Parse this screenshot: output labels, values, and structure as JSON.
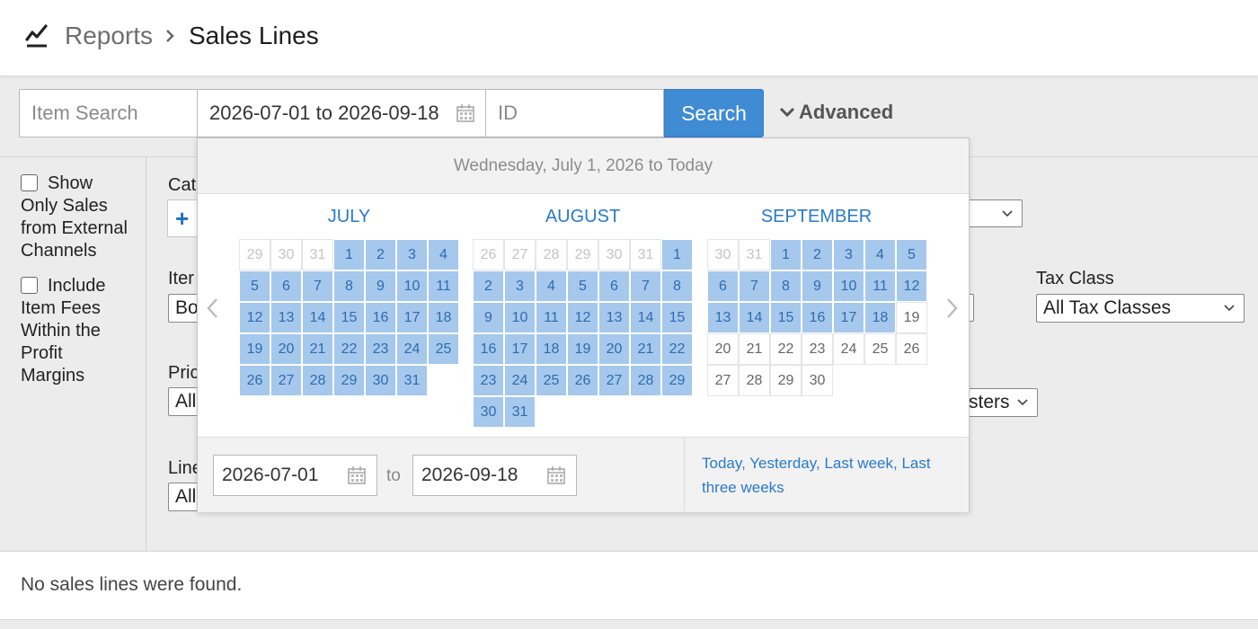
{
  "breadcrumb": {
    "parent": "Reports",
    "current": "Sales Lines"
  },
  "search": {
    "item_placeholder": "Item Search",
    "date_range_value": "2026-07-01 to 2026-09-18",
    "id_placeholder": "ID",
    "search_label": "Search",
    "advanced_label": "Advanced"
  },
  "sidebar": {
    "external_channels_label": "Show Only Sales from External Channels",
    "item_fees_label": "Include Item Fees Within the Profit Margins"
  },
  "filters": {
    "category_fragment": "Cat",
    "item_fragment": "Iter",
    "item_select_fragment": "Bo",
    "price_fragment": "Pric",
    "price_select_fragment": "All",
    "line_fragment": "Line",
    "line_select_fragment": "All",
    "tax_class_label": "Tax Class",
    "tax_class_value": "All Tax Classes",
    "registers_fragment": "sters"
  },
  "results": {
    "empty_message": "No sales lines were found."
  },
  "date_picker": {
    "header": "Wednesday, July 1, 2026 to Today",
    "months": [
      {
        "title": "JULY",
        "days": [
          "29",
          "30",
          "31",
          "1",
          "2",
          "3",
          "4",
          "5",
          "6",
          "7",
          "8",
          "9",
          "10",
          "11",
          "12",
          "13",
          "14",
          "15",
          "16",
          "17",
          "18",
          "19",
          "20",
          "21",
          "22",
          "23",
          "24",
          "25",
          "26",
          "27",
          "28",
          "29",
          "30",
          "31"
        ]
      },
      {
        "title": "AUGUST",
        "days": [
          "26",
          "27",
          "28",
          "29",
          "30",
          "31",
          "1",
          "2",
          "3",
          "4",
          "5",
          "6",
          "7",
          "8",
          "9",
          "10",
          "11",
          "12",
          "13",
          "14",
          "15",
          "16",
          "17",
          "18",
          "19",
          "20",
          "21",
          "22",
          "23",
          "24",
          "25",
          "26",
          "27",
          "28",
          "29",
          "30",
          "31"
        ]
      },
      {
        "title": "SEPTEMBER",
        "days": [
          "30",
          "31",
          "1",
          "2",
          "3",
          "4",
          "5",
          "6",
          "7",
          "8",
          "9",
          "10",
          "11",
          "12",
          "13",
          "14",
          "15",
          "16",
          "17",
          "18",
          "19",
          "20",
          "21",
          "22",
          "23",
          "24",
          "25",
          "26",
          "27",
          "28",
          "29",
          "30"
        ]
      }
    ],
    "start_value": "2026-07-01",
    "end_value": "2026-09-18",
    "to_label": "to",
    "quick_links": [
      "Today,",
      "Yesterday,",
      "Last week,",
      "Last three weeks"
    ]
  },
  "colors": {
    "accent": "#3f8bd4",
    "selected_day": "#a5c8ec",
    "link": "#2a7ac9"
  }
}
